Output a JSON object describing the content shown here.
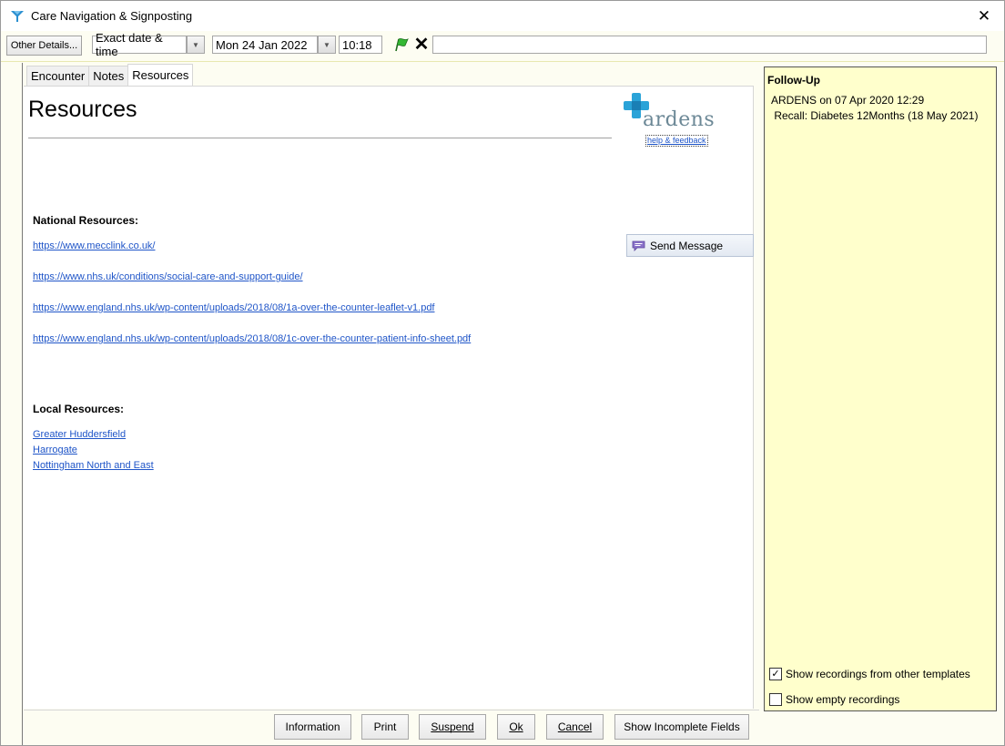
{
  "window": {
    "title": "Care Navigation & Signposting",
    "close_glyph": "✕"
  },
  "toolbar": {
    "other_details_label": "Other Details...",
    "date_mode_value": "Exact date & time",
    "date_value": "Mon 24 Jan 2022",
    "time_value": "10:18",
    "clear_glyph": "✕",
    "note_value": ""
  },
  "tabs": [
    {
      "label": "Encounter",
      "active": false
    },
    {
      "label": "Notes",
      "active": false
    },
    {
      "label": "Resources",
      "active": true
    }
  ],
  "page": {
    "title": "Resources",
    "logo_text": "ardens",
    "logo_link": "help & feedback",
    "send_message_label": "Send Message",
    "national_heading": "National Resources:",
    "national_links": [
      "https://www.mecclink.co.uk/",
      "https://www.nhs.uk/conditions/social-care-and-support-guide/",
      "https://www.england.nhs.uk/wp-content/uploads/2018/08/1a-over-the-counter-leaflet-v1.pdf",
      "https://www.england.nhs.uk/wp-content/uploads/2018/08/1c-over-the-counter-patient-info-sheet.pdf"
    ],
    "local_heading": "Local Resources:",
    "local_links": [
      "Greater Huddersfield",
      "Harrogate",
      "Nottingham North and East"
    ]
  },
  "actions": {
    "information": "Information",
    "print": "Print",
    "suspend": "Suspend",
    "ok": "Ok",
    "cancel": "Cancel",
    "show_incomplete": "Show Incomplete Fields"
  },
  "follow_up": {
    "title": "Follow-Up",
    "text": "ARDENS on 07 Apr 2020 12:29\n Recall: Diabetes 12Months (18 May 2021)",
    "show_other_templates_label": "Show recordings from other templates",
    "show_other_templates_checked": true,
    "show_empty_label": "Show empty recordings",
    "show_empty_checked": false
  },
  "colors": {
    "accent_link": "#1f55c8",
    "panel_yellow": "#ffffcc",
    "logo_blue": "#2aa3d8"
  }
}
